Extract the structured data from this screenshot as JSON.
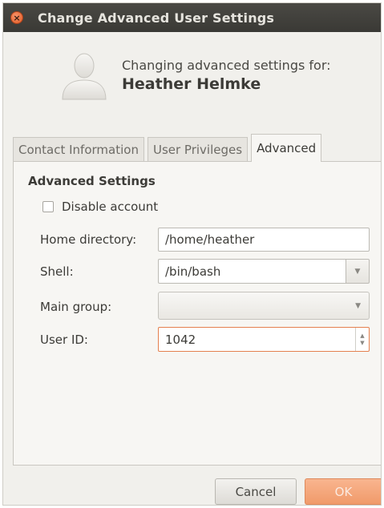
{
  "window": {
    "title": "Change Advanced User Settings",
    "close_glyph": "×"
  },
  "header": {
    "caption": "Changing advanced settings for:",
    "user_name": "Heather Helmke",
    "avatar_icon": "user-avatar-icon"
  },
  "tabs": [
    {
      "label": "Contact Information",
      "active": false
    },
    {
      "label": "User Privileges",
      "active": false
    },
    {
      "label": "Advanced",
      "active": true
    }
  ],
  "advanced": {
    "section_title": "Advanced Settings",
    "disable_account": {
      "label": "Disable account",
      "checked": false
    },
    "home_directory": {
      "label": "Home directory:",
      "value": "/home/heather"
    },
    "shell": {
      "label": "Shell:",
      "value": "/bin/bash"
    },
    "main_group": {
      "label": "Main group:",
      "value": ""
    },
    "user_id": {
      "label": "User ID:",
      "value": "1042"
    }
  },
  "buttons": {
    "cancel": "Cancel",
    "ok": "OK"
  },
  "colors": {
    "accent": "#f09a6a",
    "titlebar": "#3c3b37",
    "focus_border": "#e4804e"
  }
}
